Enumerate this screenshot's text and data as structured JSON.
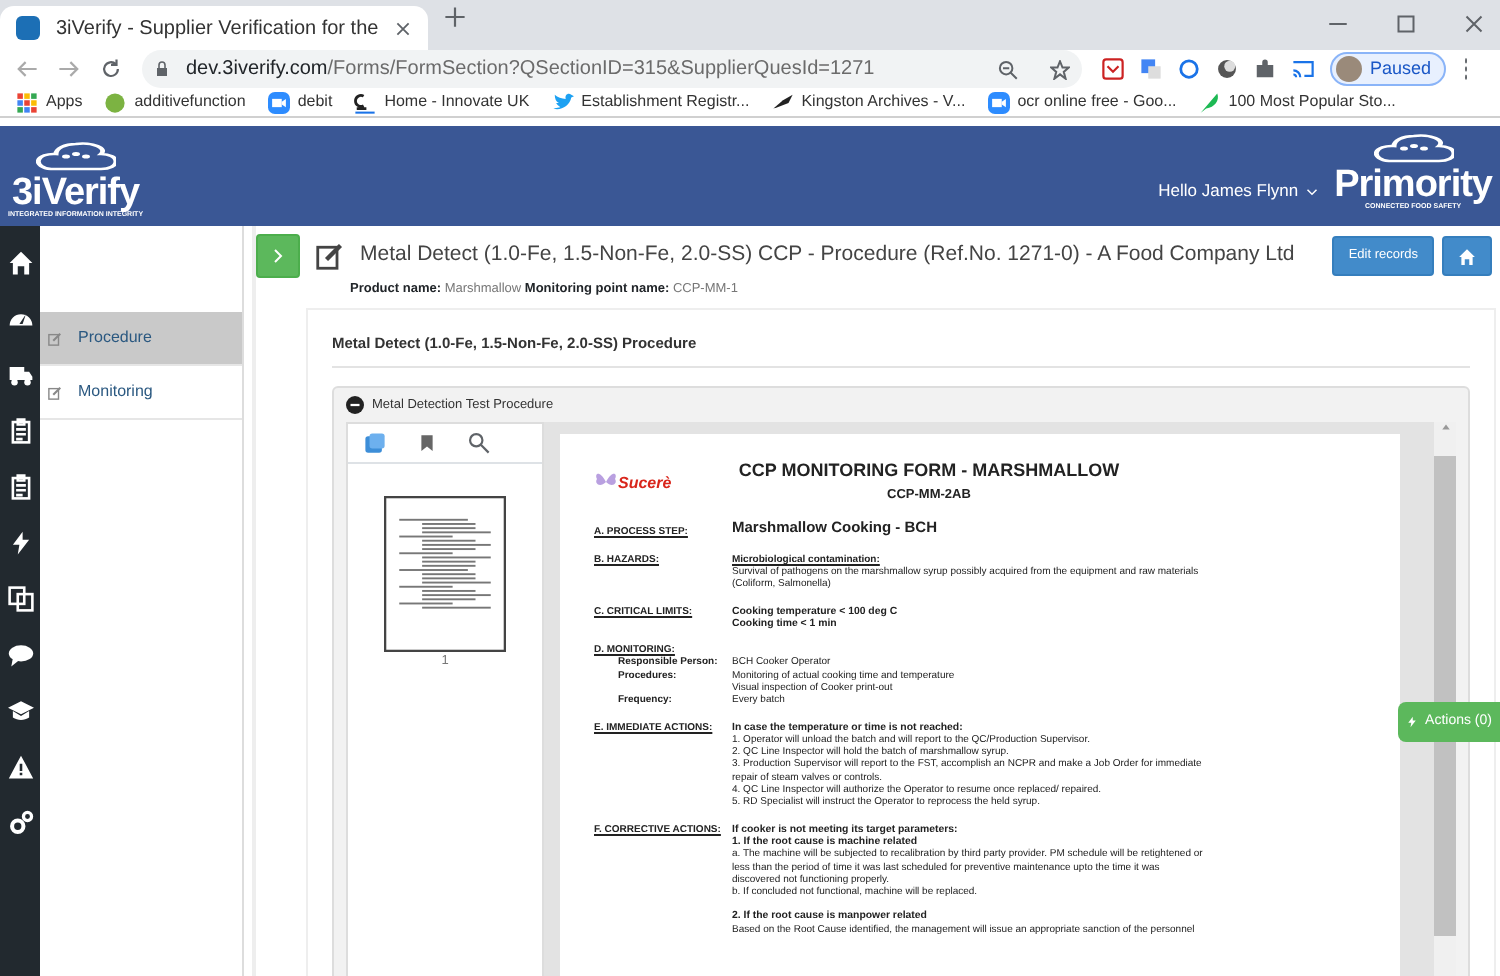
{
  "browser": {
    "tab_title": "3iVerify - Supplier Verification for the",
    "url_host": "dev.3iverify.com",
    "url_path": "/Forms/FormSection?QSectionID=315&SupplierQuesId=1271",
    "profile": "Paused",
    "bookmarks": [
      {
        "label": "Apps"
      },
      {
        "label": "additivefunction"
      },
      {
        "label": "debit"
      },
      {
        "label": "Home - Innovate UK"
      },
      {
        "label": "Establishment Registr..."
      },
      {
        "label": "Kingston Archives - V..."
      },
      {
        "label": "ocr online free - Goo..."
      },
      {
        "label": "100 Most Popular Sto..."
      }
    ]
  },
  "header": {
    "logo": "3iVerify",
    "logo_tagline": "INTEGRATED INFORMATION INTEGRITY",
    "greeting": "Hello James Flynn",
    "brand": "Primority",
    "brand_tagline": "CONNECTED FOOD SAFETY"
  },
  "side_menu": [
    {
      "label": "Procedure",
      "selected": true
    },
    {
      "label": "Monitoring",
      "selected": false
    }
  ],
  "page": {
    "title": "Metal Detect (1.0-Fe, 1.5-Non-Fe, 2.0-SS) CCP - Procedure (Ref.No. 1271-0) - A Food Company Ltd",
    "product_label": "Product name:",
    "product": "Marshmallow",
    "point_label": "Monitoring point name:",
    "point": "CCP-MM-1",
    "edit_button": "Edit records"
  },
  "card_title": "Metal Detect (1.0-Fe, 1.5-Non-Fe, 2.0-SS) Procedure",
  "panel_title": "Metal Detection Test Procedure",
  "viewer": {
    "page_number": "1",
    "actions_button": "Actions (0)"
  },
  "document": {
    "logo": "Sucerè",
    "title": "CCP MONITORING FORM - MARSHMALLOW",
    "code": "CCP-MM-2AB",
    "sections": [
      {
        "heading": "A. PROCESS STEP:",
        "lines": [
          {
            "kind": "big",
            "text": "Marshmallow Cooking - BCH"
          }
        ]
      },
      {
        "heading": "B. HAZARDS:",
        "lines": [
          {
            "kind": "underline",
            "text": "Microbiological contamination:"
          },
          {
            "kind": "normal",
            "text": "Survival of pathogens on the marshmallow syrup possibly acquired from the equipment and raw materials"
          },
          {
            "kind": "normal",
            "text": "(Coliform, Salmonella)"
          }
        ]
      },
      {
        "heading": "C. CRITICAL LIMITS:",
        "lines": [
          {
            "kind": "bold",
            "text": "Cooking temperature < 100 deg C"
          },
          {
            "kind": "bold",
            "text": "Cooking time < 1 min"
          }
        ]
      },
      {
        "heading": "D. MONITORING:",
        "fields": [
          {
            "label": "Responsible Person:",
            "values": [
              "BCH Cooker Operator"
            ]
          },
          {
            "label": "Procedures:",
            "values": [
              "Monitoring of actual cooking time and temperature",
              "Visual inspection of Cooker print-out"
            ]
          },
          {
            "label": "Frequency:",
            "values": [
              "Every batch"
            ]
          }
        ]
      },
      {
        "heading": "E. IMMEDIATE ACTIONS:",
        "lines": [
          {
            "kind": "bold",
            "text": "In case the temperature or time is not reached:"
          },
          {
            "kind": "normal",
            "text": "1. Operator will unload the batch and will report to the QC/Production Supervisor."
          },
          {
            "kind": "normal",
            "text": "2. QC Line Inspector will hold the batch of marshmallow syrup."
          },
          {
            "kind": "normal",
            "text": "3. Production Supervisor will report to the FST, accomplish an NCPR and make a Job Order for immediate"
          },
          {
            "kind": "normal",
            "text": "repair of steam valves or controls."
          },
          {
            "kind": "normal",
            "text": "4. QC Line Inspector will authorize the Operator to resume once replaced/ repaired."
          },
          {
            "kind": "normal",
            "text": "5. RD Specialist will instruct the Operator to reprocess the held syrup."
          }
        ]
      },
      {
        "heading": "F. CORRECTIVE ACTIONS:",
        "lines": [
          {
            "kind": "bold",
            "text": "If cooker is not meeting its target parameters:"
          },
          {
            "kind": "bold",
            "text": "1. If the root cause is machine related"
          },
          {
            "kind": "normal",
            "text": "a. The machine will be subjected to recalibration by third party provider. PM schedule will be retightened or"
          },
          {
            "kind": "normal",
            "text": "less than the period of time it was last scheduled for preventive maintenance upto the time it was"
          },
          {
            "kind": "normal",
            "text": "discovered not functioning properly."
          },
          {
            "kind": "normal",
            "text": "b. If concluded not functional, machine will be replaced."
          },
          {
            "kind": "subhead",
            "text": "2. If the root cause is manpower related"
          },
          {
            "kind": "normal",
            "text": "Based on the Root Cause identified, the management will issue an appropriate sanction of the personnel"
          }
        ]
      }
    ]
  }
}
